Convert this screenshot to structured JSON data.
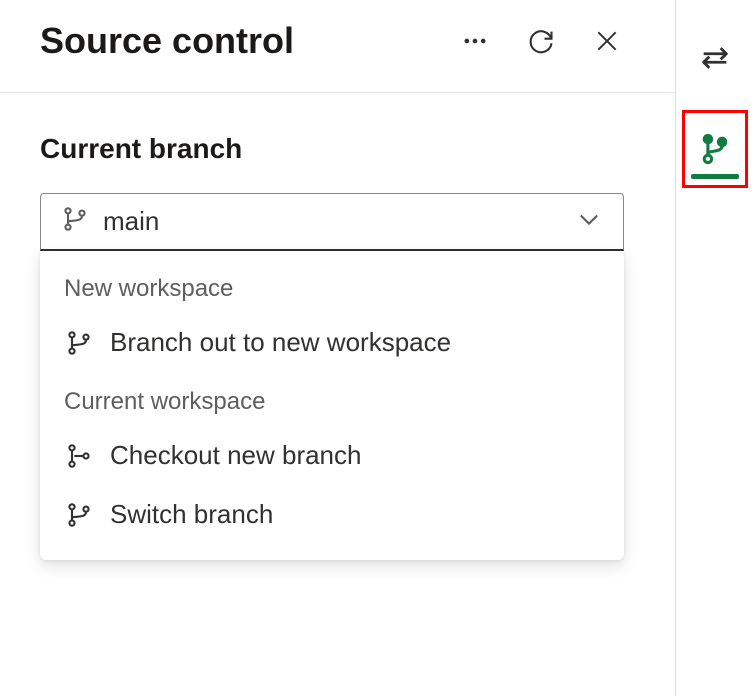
{
  "header": {
    "title": "Source control"
  },
  "section": {
    "label": "Current branch"
  },
  "dropdown": {
    "value": "main"
  },
  "menu": {
    "sections": [
      {
        "label": "New workspace",
        "items": [
          {
            "label": "Branch out to new workspace",
            "icon": "branch-icon"
          }
        ]
      },
      {
        "label": "Current workspace",
        "items": [
          {
            "label": "Checkout new branch",
            "icon": "branch-new-icon"
          },
          {
            "label": "Switch branch",
            "icon": "branch-icon"
          }
        ]
      }
    ]
  }
}
